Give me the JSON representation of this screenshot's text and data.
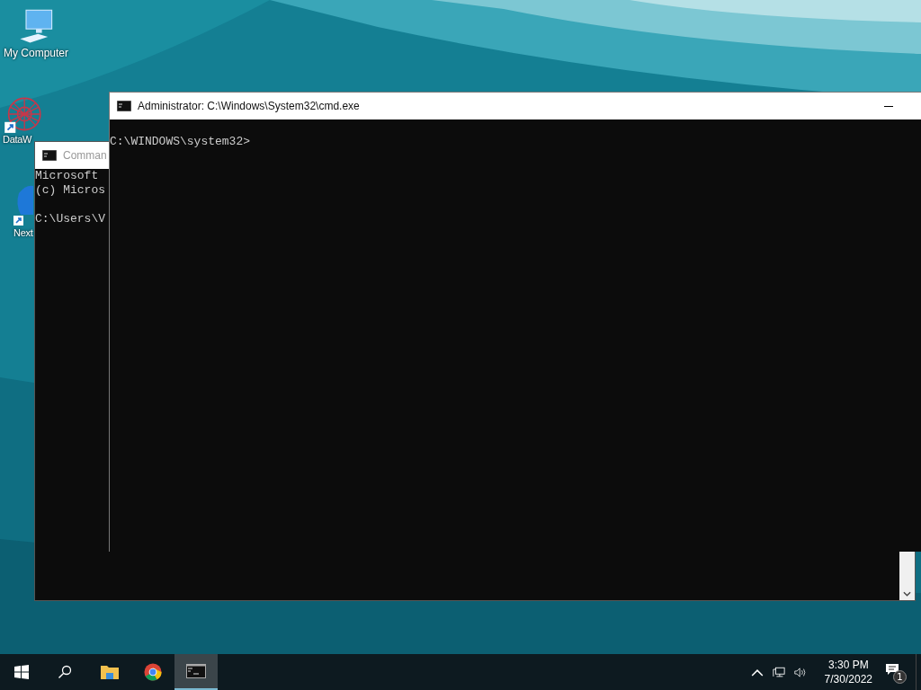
{
  "desktop_icons": [
    {
      "kind": "computer",
      "label": "My Computer"
    },
    {
      "kind": "network",
      "label": "DataW"
    },
    {
      "kind": "blue",
      "label": "Next"
    }
  ],
  "windows": [
    {
      "title": "Comman",
      "lines": [
        {
          "text": "Microsoft",
          "blank_before": false
        },
        {
          "text": "(c) Micros",
          "blank_before": false
        },
        {
          "text": "C:\\Users\\V",
          "blank_before": true
        }
      ],
      "active": false
    },
    {
      "title": "Administrator: C:\\Windows\\System32\\cmd.exe",
      "lines": [
        {
          "text": "C:\\WINDOWS\\system32>",
          "blank_before": true
        }
      ],
      "active": true
    }
  ],
  "taskbar": {
    "apps": [
      {
        "kind": "explorer",
        "selected": false
      },
      {
        "kind": "chrome",
        "selected": false
      },
      {
        "kind": "cmd",
        "selected": true
      }
    ],
    "time": "3:30 PM",
    "date": "7/30/2022",
    "notifications": "1"
  }
}
